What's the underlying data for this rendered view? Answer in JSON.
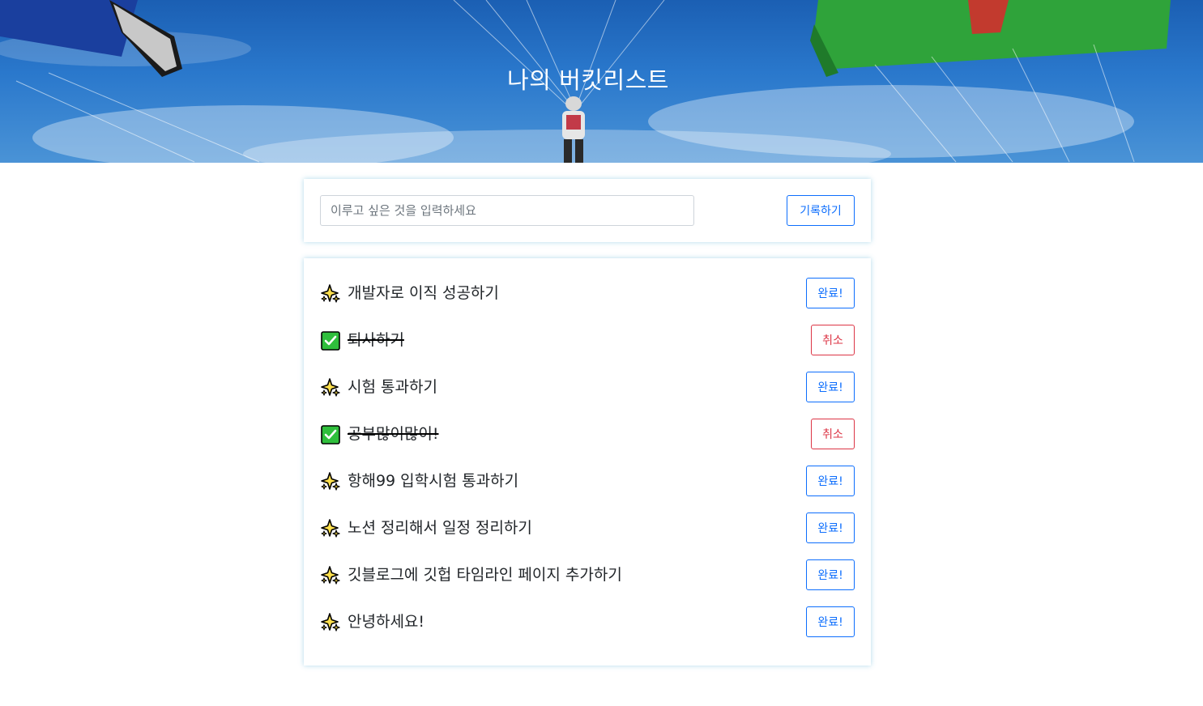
{
  "header": {
    "title": "나의 버킷리스트"
  },
  "form": {
    "placeholder": "이루고 싶은 것을 입력하세요",
    "value": "",
    "submit_label": "기록하기"
  },
  "buttons": {
    "complete_label": "완료!",
    "cancel_label": "취소"
  },
  "colors": {
    "primary": "#0d6efd",
    "danger": "#dc3545",
    "check_green": "#2fbf3c",
    "sparkle_yellow": "#ffe14d"
  },
  "items": [
    {
      "text": "개발자로 이직 성공하기",
      "done": false,
      "icon": "sparkles-icon"
    },
    {
      "text": "퇴사하기",
      "done": true,
      "icon": "check-mark-icon"
    },
    {
      "text": "시험 통과하기",
      "done": false,
      "icon": "sparkles-icon"
    },
    {
      "text": "공부많이많이!",
      "done": true,
      "icon": "check-mark-icon"
    },
    {
      "text": "항해99 입학시험 통과하기",
      "done": false,
      "icon": "sparkles-icon"
    },
    {
      "text": "노션 정리해서 일정 정리하기",
      "done": false,
      "icon": "sparkles-icon"
    },
    {
      "text": "깃블로그에 깃헙 타임라인 페이지 추가하기",
      "done": false,
      "icon": "sparkles-icon"
    },
    {
      "text": "안녕하세요!",
      "done": false,
      "icon": "sparkles-icon"
    }
  ]
}
